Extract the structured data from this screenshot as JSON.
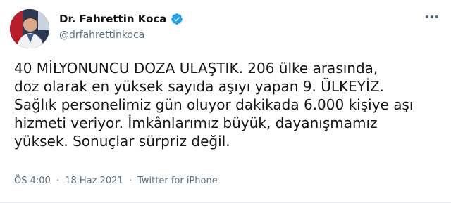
{
  "author": {
    "display_name": "Dr. Fahrettin Koca",
    "handle": "@drfahrettinkoca",
    "verified": true
  },
  "tweet": {
    "lines": [
      "40 MİLYONUNCU DOZA ULAŞTIK. 206 ülke arasında,",
      "doz olarak en yüksek sayıda aşıyı yapan 9. ÜLKEYİZ.",
      "Sağlık personelimiz gün oluyor dakikada 6.000 kişiye aşı",
      "hizmeti veriyor. İmkânlarımız büyük, dayanışmamız",
      "yüksek. Sonuçlar sürpriz değil."
    ]
  },
  "meta": {
    "time": "ÖS 4:00",
    "separator": "·",
    "date": "18 Haz 2021",
    "source": "Twitter for iPhone"
  },
  "icons": {
    "verified": "verified-badge-icon",
    "more": "more-options-icon"
  },
  "colors": {
    "text": "#14171a",
    "secondary": "#5b7083",
    "verified_blue": "#1da1f2"
  }
}
